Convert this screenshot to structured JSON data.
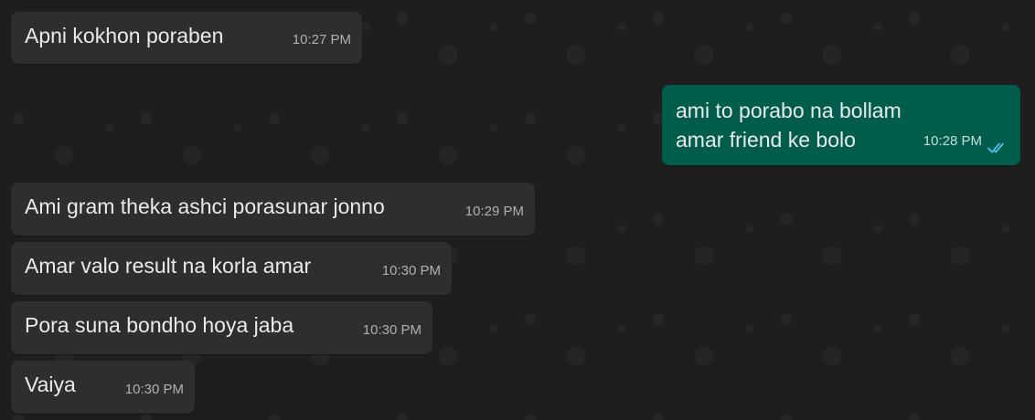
{
  "messages": [
    {
      "direction": "incoming",
      "text": "Apni kokhon poraben",
      "time": "10:27 PM"
    },
    {
      "direction": "outgoing",
      "text": "ami to porabo na bollam\namar friend ke bolo",
      "time": "10:28 PM",
      "status_icon": "double-check-read-icon"
    },
    {
      "direction": "incoming",
      "text": "Ami gram theka ashci porasunar jonno",
      "time": "10:29 PM"
    },
    {
      "direction": "incoming",
      "text": "Amar valo result na korla amar",
      "time": "10:30 PM"
    },
    {
      "direction": "incoming",
      "text": "Pora suna bondho hoya jaba",
      "time": "10:30 PM"
    },
    {
      "direction": "incoming",
      "text": "Vaiya",
      "time": "10:30 PM"
    }
  ],
  "colors": {
    "background": "#1e1e1e",
    "incoming_bubble": "#2e2e2e",
    "outgoing_bubble": "#005c4b",
    "read_ticks": "#53bdeb"
  }
}
